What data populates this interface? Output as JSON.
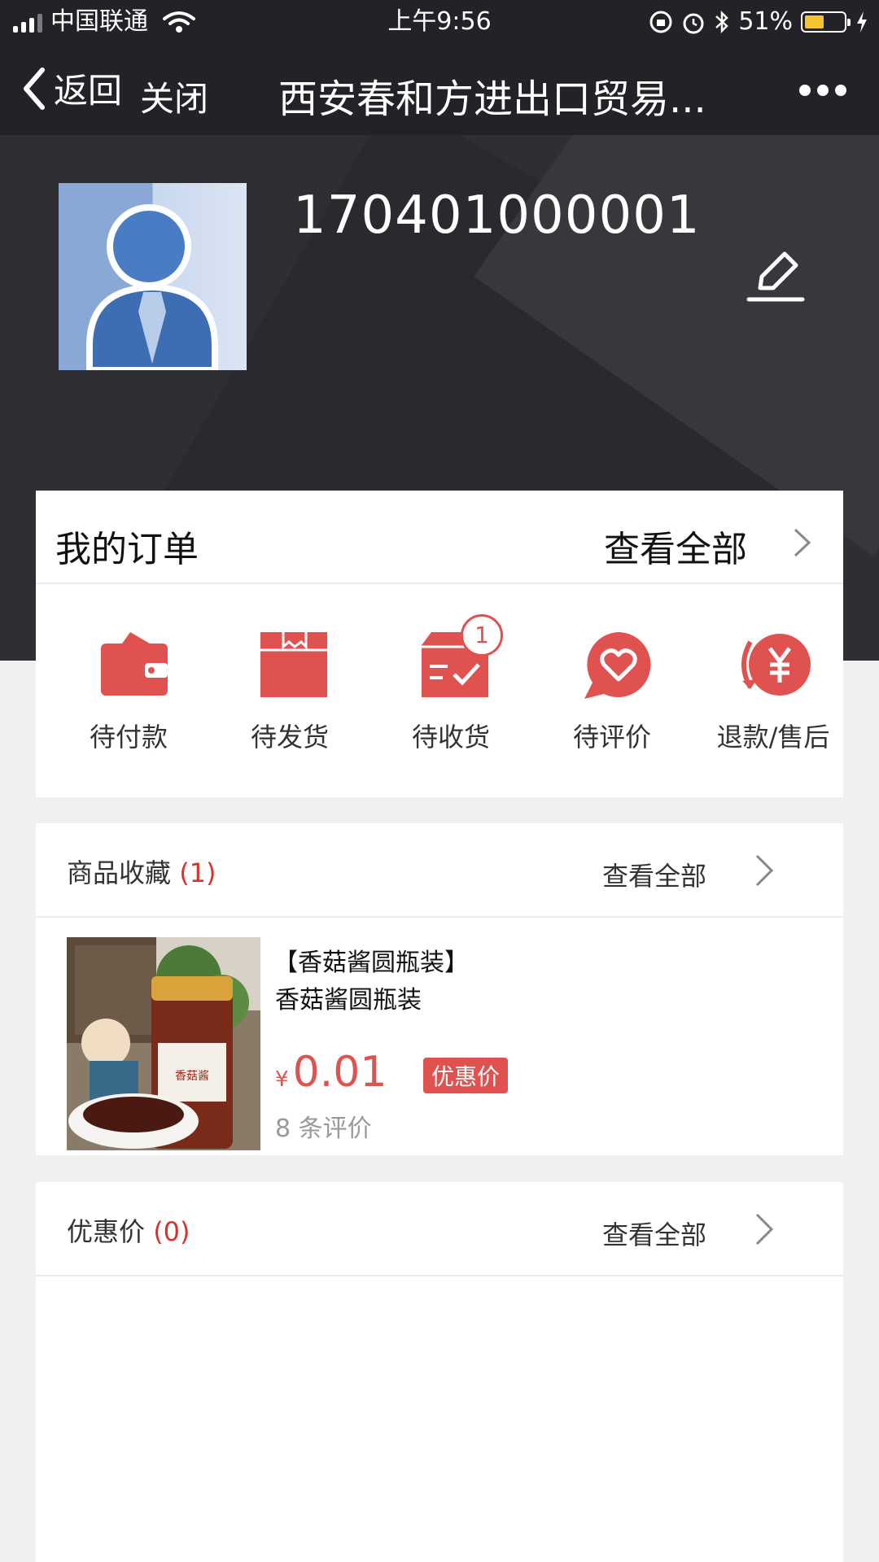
{
  "status_bar": {
    "carrier": "中国联通",
    "time": "上午9:56",
    "battery_percent": "51%",
    "battery_level": 0.51
  },
  "nav": {
    "back_label": "返回",
    "close_label": "关闭",
    "title": "西安春和方进出口贸易..."
  },
  "profile": {
    "username": "170401000001"
  },
  "orders": {
    "title": "我的订单",
    "view_all": "查看全部",
    "items": [
      {
        "label": "待付款",
        "icon": "wallet-icon"
      },
      {
        "label": "待发货",
        "icon": "box-icon"
      },
      {
        "label": "待收货",
        "icon": "delivery-check-icon",
        "badge": "1"
      },
      {
        "label": "待评价",
        "icon": "heart-chat-icon"
      },
      {
        "label": "退款/售后",
        "icon": "yen-refund-icon"
      }
    ]
  },
  "favorites": {
    "title": "商品收藏",
    "count": "(1)",
    "view_all": "查看全部",
    "product": {
      "name_line1": "【香菇酱圆瓶装】",
      "name_line2": "香菇酱圆瓶装",
      "currency": "¥",
      "price": "0.01",
      "tag": "优惠价",
      "reviews": "8 条评价",
      "jar_label": "香菇酱"
    }
  },
  "promo": {
    "title": "优惠价",
    "count": "(0)",
    "view_all": "查看全部"
  },
  "colors": {
    "accent": "#e0524f",
    "header_bg": "#232327",
    "profile_bg": "#2f2f33"
  }
}
